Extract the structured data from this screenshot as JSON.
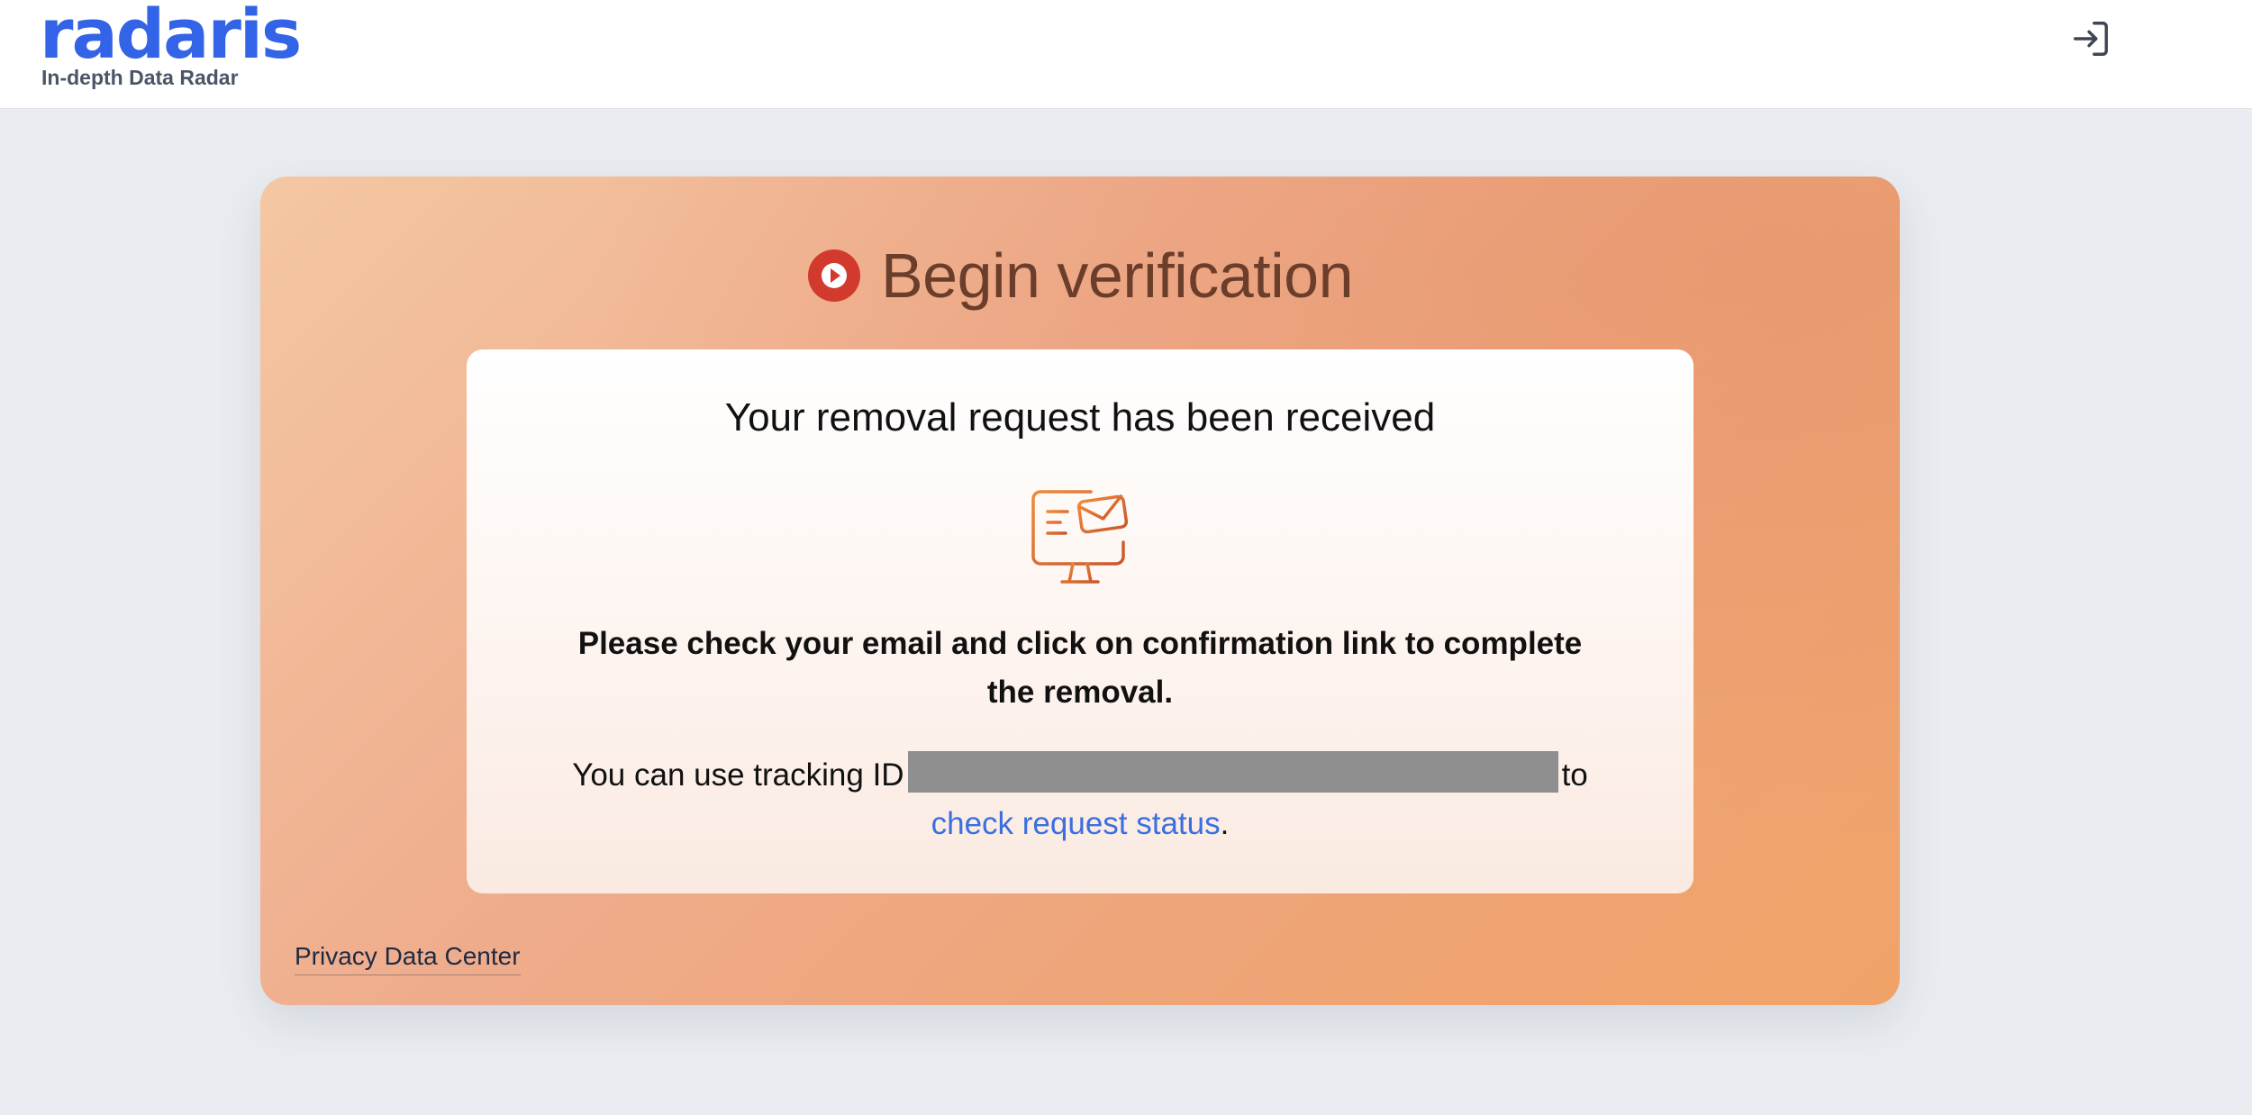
{
  "header": {
    "logo_text": "radaris",
    "tagline": "In-depth Data Radar",
    "login_icon": "login-icon"
  },
  "card": {
    "title": "Begin verification",
    "title_icon": "play-circle-icon",
    "received_heading": "Your removal request has been received",
    "email_icon": "monitor-email-icon",
    "instructions": "Please check your email and click on confirmation link to complete the removal.",
    "tracking_prefix": "You can use tracking ID",
    "tracking_suffix": "to",
    "status_link_label": "check request status",
    "status_link_trailer": ".",
    "footer_link": "Privacy Data Center"
  },
  "colors": {
    "brand": "#3363e6",
    "title": "#6b3e2b",
    "play_icon": "#d23a2e",
    "email_icon": "#e07a3c",
    "link": "#3b6fe0",
    "background": "#e9edf1"
  }
}
